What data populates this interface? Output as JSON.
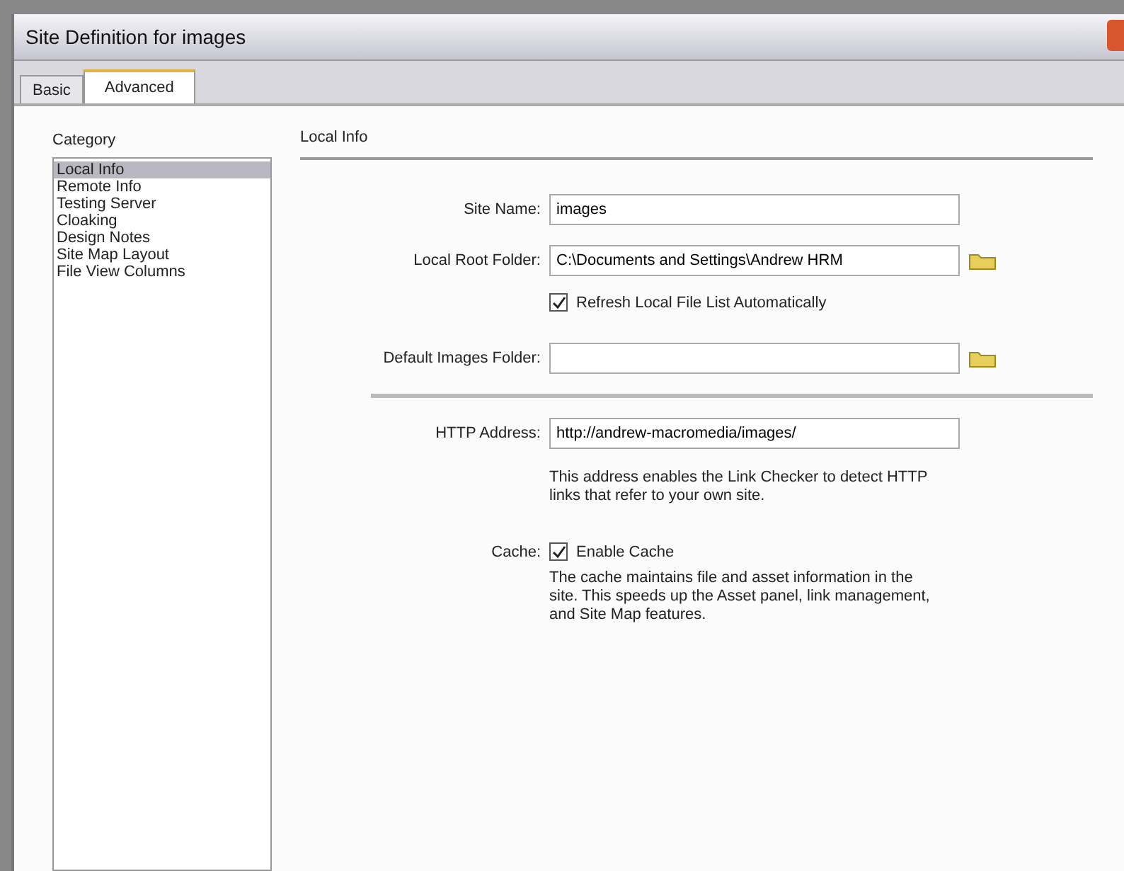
{
  "window": {
    "title": "Site Definition for images"
  },
  "tabs": [
    {
      "label": "Basic",
      "selected": false
    },
    {
      "label": "Advanced",
      "selected": true
    }
  ],
  "category": {
    "label": "Category",
    "items": [
      {
        "label": "Local Info",
        "selected": true
      },
      {
        "label": "Remote Info",
        "selected": false
      },
      {
        "label": "Testing Server",
        "selected": false
      },
      {
        "label": "Cloaking",
        "selected": false
      },
      {
        "label": "Design Notes",
        "selected": false
      },
      {
        "label": "Site Map Layout",
        "selected": false
      },
      {
        "label": "File View Columns",
        "selected": false
      }
    ]
  },
  "section": {
    "title": "Local Info"
  },
  "site_name": {
    "label": "Site Name:",
    "value": "images"
  },
  "local_root": {
    "label": "Local Root Folder:",
    "value": "C:\\Documents and Settings\\Andrew HRM"
  },
  "refresh": {
    "label": "Refresh Local File List Automatically",
    "checked": true
  },
  "default_images": {
    "label": "Default Images Folder:"
  },
  "http": {
    "label": "HTTP Address:",
    "value": "http://andrew-macromedia/images/",
    "help": "This address enables the Link Checker to detect HTTP links that refer to your own site."
  },
  "cache": {
    "label": "Cache:",
    "checkbox": "Enable Cache",
    "checked": true,
    "help": "The cache maintains file and asset information in the site. This speeds up the Asset panel, link management, and Site Map features."
  }
}
